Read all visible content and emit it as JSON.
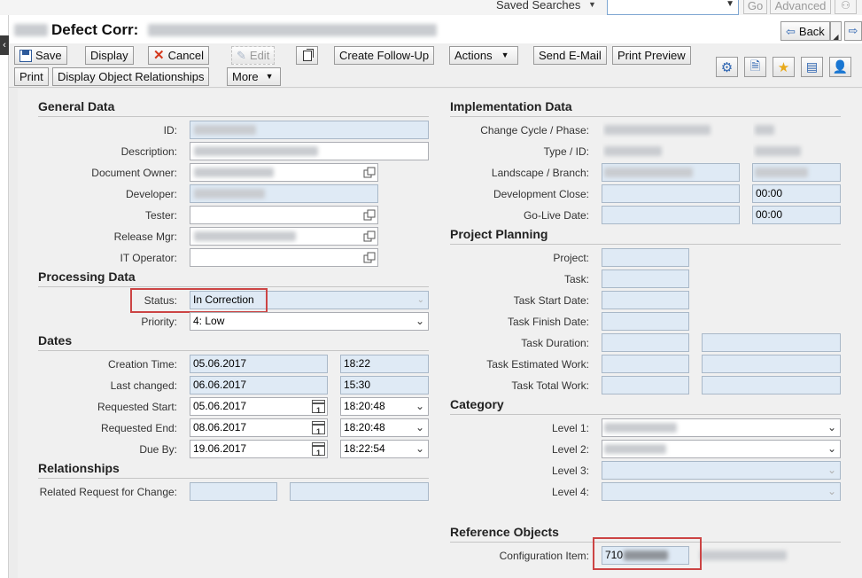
{
  "search": {
    "saved_label": "Saved Searches",
    "go_label": "Go",
    "advanced_label": "Advanced",
    "input_value": ""
  },
  "header": {
    "title_prefix": "Defect Corr:",
    "back_label": "Back"
  },
  "toolbar": {
    "save": "Save",
    "display": "Display",
    "cancel": "Cancel",
    "edit": "Edit",
    "create_follow_up": "Create Follow-Up",
    "actions": "Actions",
    "send_email": "Send E-Mail",
    "print_preview": "Print Preview",
    "print": "Print",
    "display_rel": "Display Object Relationships",
    "more": "More"
  },
  "general": {
    "title": "General Data",
    "id_label": "ID:",
    "description_label": "Description:",
    "owner_label": "Document Owner:",
    "developer_label": "Developer:",
    "tester_label": "Tester:",
    "release_label": "Release Mgr:",
    "it_operator_label": "IT Operator:"
  },
  "processing": {
    "title": "Processing Data",
    "status_label": "Status:",
    "status_value": "In Correction",
    "priority_label": "Priority:",
    "priority_value": "4: Low"
  },
  "dates": {
    "title": "Dates",
    "creation_label": "Creation Time:",
    "creation_date": "05.06.2017",
    "creation_time": "18:22",
    "changed_label": "Last changed:",
    "changed_date": "06.06.2017",
    "changed_time": "15:30",
    "req_start_label": "Requested Start:",
    "req_start_date": "05.06.2017",
    "req_start_time": "18:20:48",
    "req_end_label": "Requested End:",
    "req_end_date": "08.06.2017",
    "req_end_time": "18:20:48",
    "due_label": "Due By:",
    "due_date": "19.06.2017",
    "due_time": "18:22:54"
  },
  "relationships": {
    "title": "Relationships",
    "rfc_label": "Related Request for Change:"
  },
  "implementation": {
    "title": "Implementation Data",
    "cycle_label": "Change Cycle / Phase:",
    "type_label": "Type / ID:",
    "landscape_label": "Landscape / Branch:",
    "dev_close_label": "Development Close:",
    "dev_close_time": "00:00",
    "golive_label": "Go-Live Date:",
    "golive_time": "00:00"
  },
  "planning": {
    "title": "Project Planning",
    "project_label": "Project:",
    "task_label": "Task:",
    "task_start_label": "Task Start Date:",
    "task_finish_label": "Task Finish Date:",
    "task_duration_label": "Task Duration:",
    "task_est_label": "Task Estimated Work:",
    "task_total_label": "Task Total Work:"
  },
  "category": {
    "title": "Category",
    "l1": "Level 1:",
    "l2": "Level 2:",
    "l3": "Level 3:",
    "l4": "Level 4:"
  },
  "reference": {
    "title": "Reference Objects",
    "ci_label": "Configuration Item:",
    "ci_value": "710"
  },
  "colors": {
    "field_bg": "#dfeaf5",
    "highlight": "#c44444"
  }
}
